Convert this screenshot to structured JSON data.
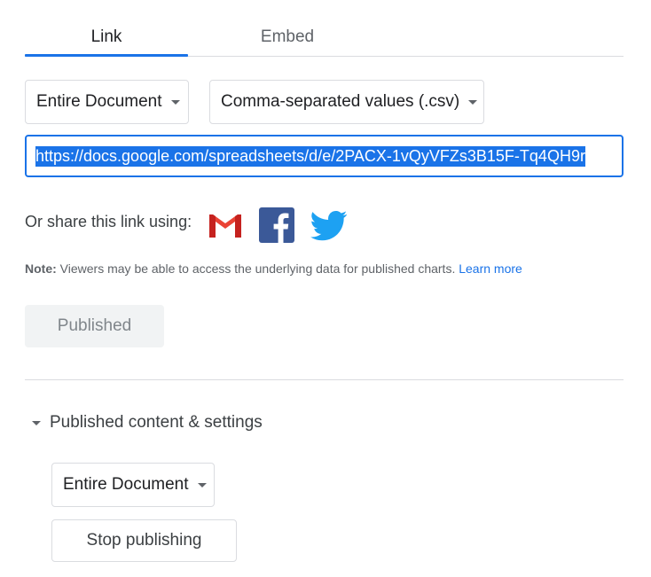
{
  "tabs": [
    {
      "label": "Link",
      "active": true
    },
    {
      "label": "Embed",
      "active": false
    }
  ],
  "publish": {
    "scope_value": "Entire Document",
    "format_value": "Comma-separated values (.csv)",
    "url": "https://docs.google.com/spreadsheets/d/e/2PACX-1vQyVFZs3B15F-Tq4QH9r"
  },
  "share": {
    "label": "Or share this link using:",
    "icons": [
      "gmail-icon",
      "facebook-icon",
      "twitter-icon"
    ]
  },
  "note": {
    "prefix": "Note:",
    "text": " Viewers may be able to access the underlying data for published charts. ",
    "link": "Learn more"
  },
  "status_button": "Published",
  "settings": {
    "toggle_label": "Published content & settings",
    "scope_value": "Entire Document",
    "stop_button": "Stop publishing"
  },
  "colors": {
    "accent": "#1a73e8",
    "gmail_red": "#ea4335",
    "facebook_blue": "#3b5998",
    "twitter_blue": "#1da1f2"
  }
}
